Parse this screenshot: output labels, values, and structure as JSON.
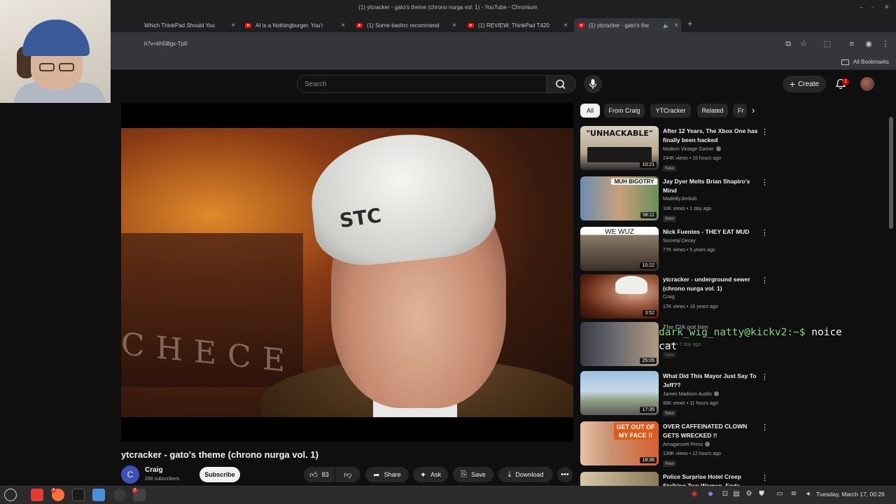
{
  "window": {
    "title": "(1) ytcracker - gato's theme (chrono nurga vol. 1) - YouTube - Chromium"
  },
  "tabs": [
    {
      "label": "Which ThinkPad Should You"
    },
    {
      "label": "AI is a Nothingburger. You'r"
    },
    {
      "label": "(1) Some bashrc recommend"
    },
    {
      "label": "(1) REVIEW: ThinkPad T420"
    },
    {
      "label": "(1) ytcracker - gato's the"
    }
  ],
  "address": {
    "url": "h?v=kh5l8gx-Tp0"
  },
  "bookmarks": {
    "all_label": "All Bookmarks"
  },
  "header": {
    "search_placeholder": "Search",
    "create_label": "Create",
    "notification_count": "1"
  },
  "video": {
    "title": "ytcracker - gato's theme (chrono nurga vol. 1)",
    "hat_logo": "STC",
    "background_letters": "CHECE",
    "channel": {
      "initial": "C",
      "name": "Craig",
      "subscribers": "268 subscribers"
    },
    "subscribe_label": "Subscribe",
    "like_count": "83",
    "share_label": "Share",
    "ask_label": "Ask",
    "save_label": "Save",
    "download_label": "Download"
  },
  "chips": [
    {
      "label": "All"
    },
    {
      "label": "From Craig"
    },
    {
      "label": "YTCracker"
    },
    {
      "label": "Related"
    },
    {
      "label": "Fr"
    }
  ],
  "recommendations": [
    {
      "title": "After 12 Years, The Xbox One has finally been hacked",
      "channel": "Modern Vintage Gamer",
      "meta": "244K views • 16 hours ago",
      "badge": "New",
      "duration": "10:21",
      "thumb_text": "\"UNHACKABLE\""
    },
    {
      "title": "Jay Dyer Melts Brian Shapiro's Mind",
      "channel": "MadeByJimbob",
      "meta": "10K views • 1 day ago",
      "badge": "New",
      "duration": "58:11",
      "thumb_text": "MUH BIGOTRY"
    },
    {
      "title": "Nick Fuentes - THEY EAT MUD",
      "channel": "Societal Decay",
      "meta": "77K views • 5 years ago",
      "badge": "",
      "duration": "10:22",
      "thumb_text": "WE WUZ"
    },
    {
      "title": "ytcracker - underground sewer (chrono nurga vol. 1)",
      "channel": "Craig",
      "meta": "17K views • 16 years ago",
      "badge": "",
      "duration": "3:52",
      "thumb_text": ""
    },
    {
      "title": "The CIA got him",
      "channel": "",
      "meta": "views • 1 day ago",
      "badge": "New",
      "duration": "25:05",
      "thumb_text": ""
    },
    {
      "title": "What Did This Mayor Just Say To Jeff??",
      "channel": "James Madison Audits",
      "meta": "99K views • 11 hours ago",
      "badge": "New",
      "duration": "17:35",
      "thumb_text": ""
    },
    {
      "title": "OVER CAFFEINATED CLOWN GETS WRECKED !!",
      "channel": "Amagansett Press",
      "meta": "139K views • 12 hours ago",
      "badge": "New",
      "duration": "18:36",
      "thumb_text": "GET OUT OF MY FACE !!"
    },
    {
      "title": "Police Surprise Hotel Creep Stalking Two Women, Ends",
      "channel": "",
      "meta": "",
      "badge": "",
      "duration": "",
      "thumb_text": ""
    }
  ],
  "terminal": {
    "prompt": "dark_wig_natty@kickv2:~$",
    "command": "noice",
    "line2": "cat"
  },
  "taskbar": {
    "clock": "Tuesday, March 17, 00:26",
    "badges": [
      "4",
      "3"
    ]
  },
  "colors": {
    "accent": "#ff0000",
    "background": "#0f0f0f",
    "chip_bg": "#272727"
  }
}
